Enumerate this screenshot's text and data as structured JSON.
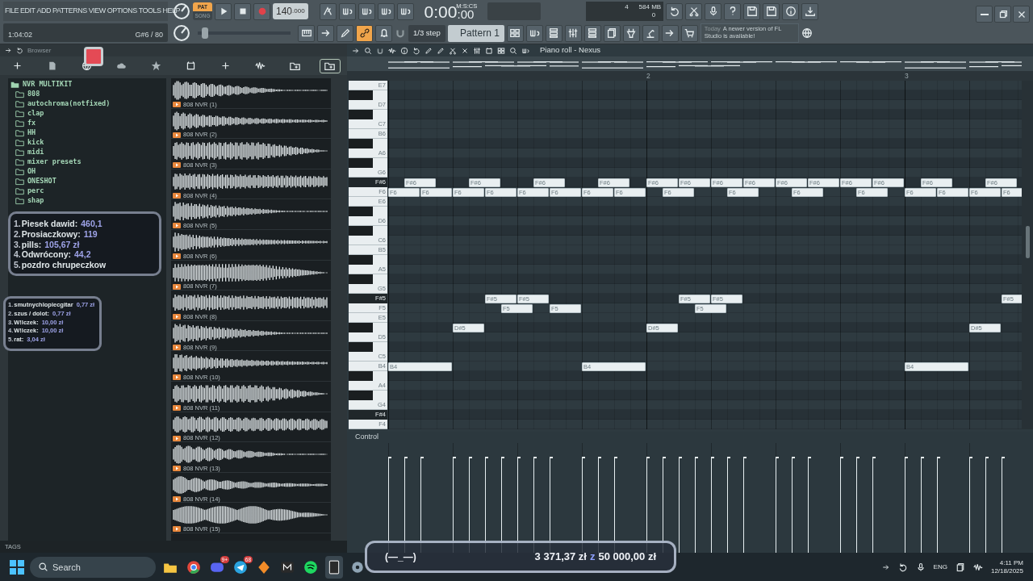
{
  "menu": [
    "FILE",
    "EDIT",
    "ADD",
    "PATTERNS",
    "VIEW",
    "OPTIONS",
    "TOOLS",
    "HELP"
  ],
  "mode_buttons": [
    {
      "label": "PAT",
      "selected": true
    },
    {
      "label": "SONG",
      "selected": false
    }
  ],
  "tempo": {
    "value": "140",
    "decimals": ".000"
  },
  "time": {
    "value": "0:00",
    "subvalue": ":00",
    "unit": "M:S:CS"
  },
  "monitor": {
    "voices": "4",
    "memory": "584 MB",
    "polyphony": "0"
  },
  "hint_bar": {
    "position": "1:04:02",
    "note": "G#6 / 80"
  },
  "master_slider": {
    "level": 0.05
  },
  "snap": {
    "value": "1/3 step"
  },
  "pattern": {
    "name": "Pattern 1"
  },
  "link_tool": {
    "on": true
  },
  "news": {
    "label": "Today",
    "text": "A newer version of FL Studio is available!"
  },
  "browser": {
    "title": "Browser",
    "toolbar": [
      {
        "selected": false
      },
      {
        "selected": false
      },
      {
        "selected": false
      },
      {
        "selected": false
      },
      {
        "selected": false
      },
      {
        "selected": false
      },
      {
        "selected": false
      },
      {
        "selected": false
      },
      {
        "selected": false
      },
      {
        "selected": true
      }
    ],
    "tree": {
      "label": "NVR MULTIKIT",
      "expanded": true,
      "children": [
        {
          "label": "808"
        },
        {
          "label": "autochroma(notfixed)"
        },
        {
          "label": "clap"
        },
        {
          "label": "fx"
        },
        {
          "label": "HH"
        },
        {
          "label": "kick"
        },
        {
          "label": "midi"
        },
        {
          "label": "mixer presets"
        },
        {
          "label": "OH"
        },
        {
          "label": "ONESHOT"
        },
        {
          "label": "perc"
        },
        {
          "label": "shap"
        }
      ]
    },
    "samples": [
      {
        "label": "808 NVR (1)"
      },
      {
        "label": "808 NVR (2)"
      },
      {
        "label": "808 NVR (3)"
      },
      {
        "label": "808 NVR (4)"
      },
      {
        "label": "808 NVR (5)"
      },
      {
        "label": "808 NVR (6)"
      },
      {
        "label": "808 NVR (7)"
      },
      {
        "label": "808 NVR (8)"
      },
      {
        "label": "808 NVR (9)"
      },
      {
        "label": "808 NVR (10)"
      },
      {
        "label": "808 NVR (11)"
      },
      {
        "label": "808 NVR (12)"
      },
      {
        "label": "808 NVR (13)"
      },
      {
        "label": "808 NVR (14)"
      },
      {
        "label": "808 NVR (15)"
      }
    ],
    "tags_label": "TAGS"
  },
  "donations": {
    "top": [
      {
        "rank": "1.",
        "name": "Piesek dawid:",
        "amount": "460,1"
      },
      {
        "rank": "2.",
        "name": "Prosiaczkowy:",
        "amount": "119"
      },
      {
        "rank": "3.",
        "name": "pills:",
        "amount": "105,67 zł"
      },
      {
        "rank": "4.",
        "name": "Odwrócony:",
        "amount": "44,2"
      },
      {
        "rank": "5.",
        "name": "pozdro chrupeczkow"
      }
    ],
    "recent": [
      {
        "rank": "1.",
        "name": "smutnychlopiecgitar",
        "amount": "0,77 zł"
      },
      {
        "rank": "2.",
        "name": "szus / dolot:",
        "amount": "0,77 zł"
      },
      {
        "rank": "3.",
        "name": "W!lczek:",
        "amount": "10,00 zł"
      },
      {
        "rank": "4.",
        "name": "W!lczek:",
        "amount": "10,00 zł"
      },
      {
        "rank": "5.",
        "name": "rat:",
        "amount": "3,04 zł"
      }
    ]
  },
  "piano_roll": {
    "title": "Piano roll - Nexus",
    "bar_numbers": [
      "2",
      "3"
    ],
    "control_label": "Control",
    "keys": [
      {
        "kind": "white",
        "label": "E7"
      },
      {
        "kind": "black"
      },
      {
        "kind": "white",
        "label": "D7"
      },
      {
        "kind": "black"
      },
      {
        "kind": "white",
        "label": "C7"
      },
      {
        "kind": "white",
        "label": "B6"
      },
      {
        "kind": "black"
      },
      {
        "kind": "white",
        "label": "A6"
      },
      {
        "kind": "black"
      },
      {
        "kind": "white",
        "label": "G6"
      },
      {
        "kind": "black",
        "label": "F#6",
        "notes": [
          {
            "label": "F#6"
          },
          {
            "label": "F#6"
          },
          {
            "label": "F#6"
          },
          {
            "label": "F#6"
          },
          {
            "label": "F#6"
          },
          {
            "label": "F#6"
          },
          {
            "label": "F#6"
          },
          {
            "label": "F#6"
          },
          {
            "label": "F#6"
          },
          {
            "label": "F#6"
          },
          {
            "label": "F#6"
          },
          {
            "label": "F#6"
          },
          {
            "label": "F#6"
          },
          {
            "label": "F#6"
          }
        ]
      },
      {
        "kind": "white",
        "label": "F6",
        "notes": [
          {
            "label": "F6"
          },
          {
            "label": "F6"
          },
          {
            "label": "F6"
          },
          {
            "label": "F6"
          },
          {
            "label": "F6"
          },
          {
            "label": "F6"
          },
          {
            "label": "F6"
          },
          {
            "label": "F6"
          },
          {
            "label": "F6"
          },
          {
            "label": "F6"
          },
          {
            "label": "F6"
          },
          {
            "label": "F6"
          },
          {
            "label": "F6"
          },
          {
            "label": "F6"
          },
          {
            "label": "F6"
          },
          {
            "label": "F6"
          }
        ]
      },
      {
        "kind": "white",
        "label": "E6"
      },
      {
        "kind": "black"
      },
      {
        "kind": "white",
        "label": "D6"
      },
      {
        "kind": "black"
      },
      {
        "kind": "white",
        "label": "C6"
      },
      {
        "kind": "white",
        "label": "B5"
      },
      {
        "kind": "black"
      },
      {
        "kind": "white",
        "label": "A5"
      },
      {
        "kind": "black"
      },
      {
        "kind": "white",
        "label": "G5"
      },
      {
        "kind": "black",
        "label": "F#5",
        "notes": [
          {
            "label": "F#5"
          },
          {
            "label": "F#5"
          },
          {
            "label": "F#5"
          },
          {
            "label": "F#5"
          },
          {
            "label": "F#5"
          }
        ]
      },
      {
        "kind": "white",
        "label": "F5",
        "notes": [
          {
            "label": "F5"
          },
          {
            "label": "F5"
          },
          {
            "label": "F5"
          }
        ]
      },
      {
        "kind": "white",
        "label": "E5"
      },
      {
        "kind": "black",
        "notes": [
          {
            "label": "D#5"
          },
          {
            "label": "D#5"
          },
          {
            "label": "D#5"
          }
        ]
      },
      {
        "kind": "white",
        "label": "D5"
      },
      {
        "kind": "black"
      },
      {
        "kind": "white",
        "label": "C5"
      },
      {
        "kind": "white",
        "label": "B4",
        "notes": [
          {
            "label": "B4"
          },
          {
            "label": "B4"
          },
          {
            "label": "B4"
          }
        ]
      },
      {
        "kind": "black"
      },
      {
        "kind": "white",
        "label": "A4"
      },
      {
        "kind": "black"
      },
      {
        "kind": "white",
        "label": "G4"
      },
      {
        "kind": "black",
        "label": "F#4"
      },
      {
        "kind": "white",
        "label": "F4"
      }
    ]
  },
  "goal": {
    "face": "(—_—)",
    "raised": "3 371,37 zł",
    "separator": "z",
    "target": "50 000,00 zł"
  },
  "taskbar": {
    "search_placeholder": "Search",
    "apps": [
      {
        "kind": "folder",
        "selected": false
      },
      {
        "kind": "chrome",
        "selected": false
      },
      {
        "kind": "discord",
        "selected": false,
        "badge": "9+"
      },
      {
        "kind": "telegram",
        "selected": false,
        "badge": "68"
      },
      {
        "kind": "fl",
        "selected": false
      },
      {
        "kind": "m",
        "selected": false
      },
      {
        "kind": "spotify",
        "selected": false
      },
      {
        "kind": "epic",
        "selected": true
      },
      {
        "kind": "gear",
        "selected": false
      }
    ],
    "language": "ENG",
    "time": "4:11 PM",
    "date": "12/18/2025"
  }
}
